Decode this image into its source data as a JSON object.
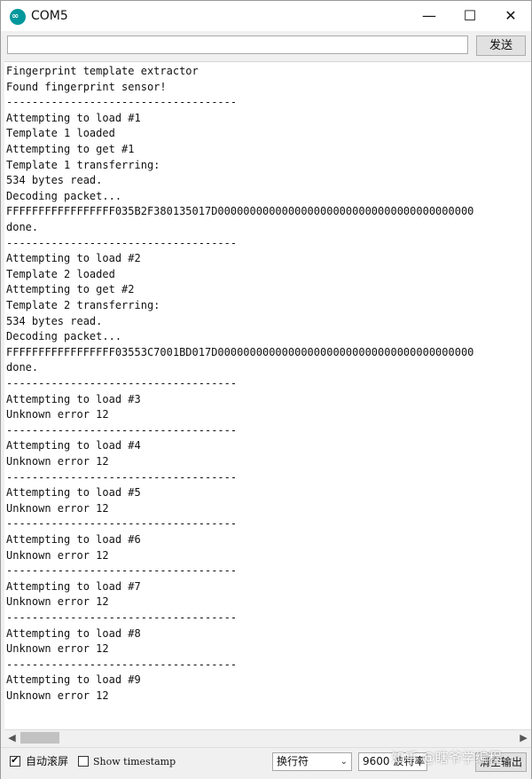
{
  "window": {
    "title": "COM5",
    "icon": "arduino-icon"
  },
  "send": {
    "input_value": "",
    "button_label": "发送"
  },
  "console_lines": [
    "Fingerprint template extractor",
    "Found fingerprint sensor!",
    "------------------------------------",
    "Attempting to load #1",
    "Template 1 loaded",
    "Attempting to get #1",
    "Template 1 transferring:",
    "534 bytes read.",
    "Decoding packet...",
    "FFFFFFFFFFFFFFFFF035B2F380135017D0000000000000000000000000000000000000000",
    "done.",
    "------------------------------------",
    "Attempting to load #2",
    "Template 2 loaded",
    "Attempting to get #2",
    "Template 2 transferring:",
    "534 bytes read.",
    "Decoding packet...",
    "FFFFFFFFFFFFFFFFF03553C7001BD017D0000000000000000000000000000000000000000",
    "done.",
    "------------------------------------",
    "Attempting to load #3",
    "Unknown error 12",
    "------------------------------------",
    "Attempting to load #4",
    "Unknown error 12",
    "------------------------------------",
    "Attempting to load #5",
    "Unknown error 12",
    "------------------------------------",
    "Attempting to load #6",
    "Unknown error 12",
    "------------------------------------",
    "Attempting to load #7",
    "Unknown error 12",
    "------------------------------------",
    "Attempting to load #8",
    "Unknown error 12",
    "------------------------------------",
    "Attempting to load #9",
    "Unknown error 12"
  ],
  "footer": {
    "autoscroll_label": "自动滚屏",
    "autoscroll_checked": true,
    "timestamp_label": "Show timestamp",
    "timestamp_checked": false,
    "line_ending": "换行符",
    "baud": "9600 波特率",
    "clear_label": "清空输出"
  },
  "watermark": "知乎 @瞎爷学编程"
}
